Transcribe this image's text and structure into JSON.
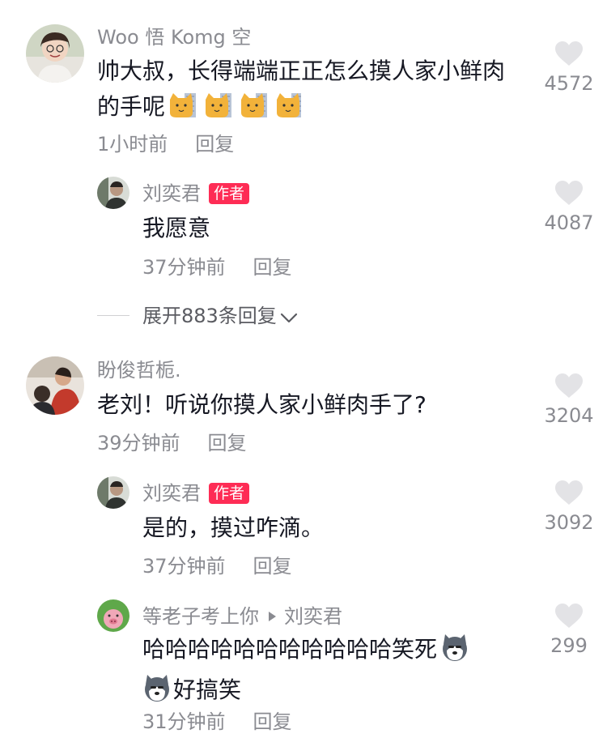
{
  "comments": [
    {
      "username": "Woo 悟 Komg 空",
      "text": "帅大叔，长得端端正正怎么摸人家小鲜肉的手呢",
      "emoji_count": 4,
      "time": "1小时前",
      "reply_label": "回复",
      "likes": "4572",
      "replies": [
        {
          "username": "刘奕君",
          "badge": "作者",
          "text": "我愿意",
          "time": "37分钟前",
          "reply_label": "回复",
          "likes": "4087"
        }
      ],
      "expand_label": "展开883条回复"
    },
    {
      "username": "盼俊哲栀.",
      "text": "老刘！听说你摸人家小鲜肉手了?",
      "time": "39分钟前",
      "reply_label": "回复",
      "likes": "3204",
      "replies": [
        {
          "username": "刘奕君",
          "badge": "作者",
          "text": "是的，摸过咋滴。",
          "time": "37分钟前",
          "reply_label": "回复",
          "likes": "3092"
        },
        {
          "username": "等老子考上你",
          "reply_to": "刘奕君",
          "text_line1": "哈哈哈哈哈哈哈哈哈哈哈笑死",
          "text_line2": "好搞笑",
          "time": "31分钟前",
          "reply_label": "回复",
          "likes": "299"
        }
      ]
    }
  ],
  "colors": {
    "text": "#161823",
    "secondary": "#8a8b91",
    "badge": "#fe2c55",
    "heart": "#e3e3e6"
  },
  "icons": [
    "heart-icon",
    "cat-emoji-icon",
    "husky-emoji-icon",
    "chevron-down-icon",
    "reply-arrow-icon"
  ]
}
